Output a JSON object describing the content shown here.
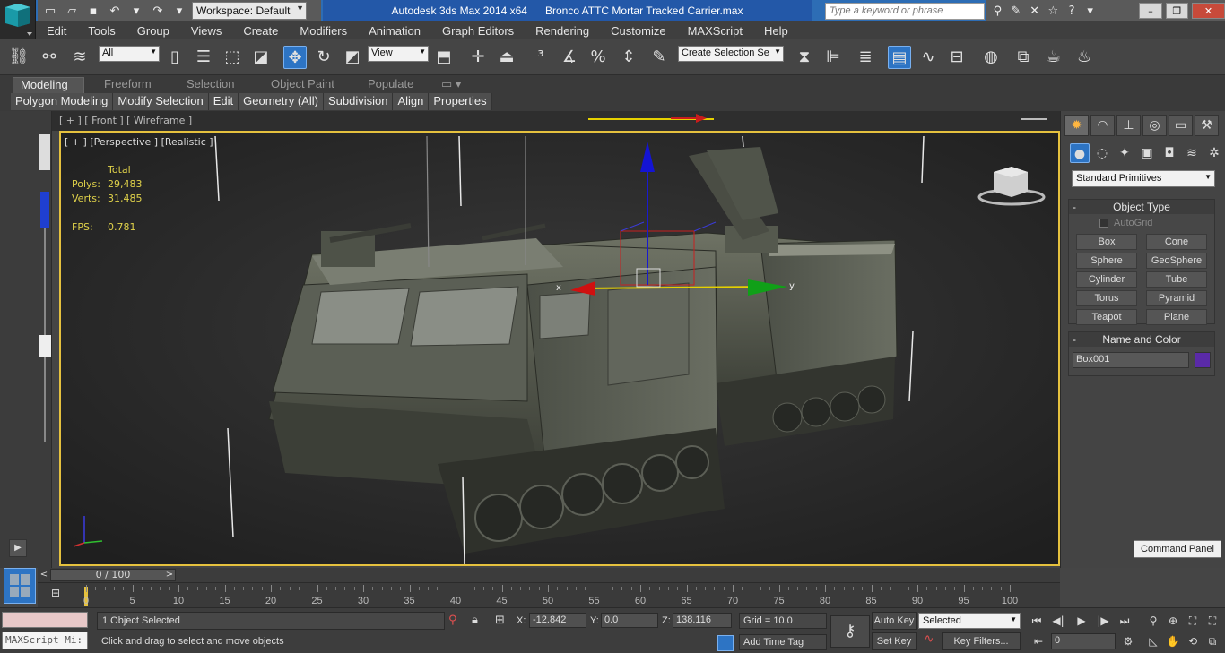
{
  "titlebar": {
    "workspace": "Workspace: Default",
    "app_title": "Autodesk 3ds Max  2014 x64",
    "file_title": "Bronco ATTC Mortar Tracked Carrier.max",
    "search_placeholder": "Type a keyword or phrase"
  },
  "menu": [
    "Edit",
    "Tools",
    "Group",
    "Views",
    "Create",
    "Modifiers",
    "Animation",
    "Graph Editors",
    "Rendering",
    "Customize",
    "MAXScript",
    "Help"
  ],
  "toolbar": {
    "filter": "All",
    "ref_coord": "View",
    "named_selection": "Create Selection Se"
  },
  "ribbon": {
    "tabs": [
      "Modeling",
      "Freeform",
      "Selection",
      "Object Paint",
      "Populate"
    ],
    "panels": [
      "Polygon Modeling",
      "Modify Selection",
      "Edit",
      "Geometry (All)",
      "Subdivision",
      "Align",
      "Properties"
    ]
  },
  "viewport": {
    "top_label": "[ + ] [ Front ] [ Wireframe ]",
    "label": "[ + ] [Perspective ] [Realistic ]",
    "stats_header": "Total",
    "polys_label": "Polys:",
    "polys_value": "29,483",
    "verts_label": "Verts:",
    "verts_value": "31,485",
    "fps_label": "FPS:",
    "fps_value": "0.781",
    "gizmo_x": "x",
    "gizmo_y": "y"
  },
  "command_panel": {
    "category": "Standard Primitives",
    "object_type_title": "Object Type",
    "autogrid": "AutoGrid",
    "buttons": [
      "Box",
      "Cone",
      "Sphere",
      "GeoSphere",
      "Cylinder",
      "Tube",
      "Torus",
      "Pyramid",
      "Teapot",
      "Plane"
    ],
    "name_color_title": "Name and Color",
    "object_name": "Box001",
    "object_color": "#5a2aa8",
    "tooltip": "Command Panel"
  },
  "timeline": {
    "position": "0 / 100",
    "ticks": [
      "0",
      "5",
      "10",
      "15",
      "20",
      "25",
      "30",
      "35",
      "40",
      "45",
      "50",
      "55",
      "60",
      "65",
      "70",
      "75",
      "80",
      "85",
      "90",
      "95",
      "100"
    ]
  },
  "status": {
    "maxscript": "MAXScript Mi:",
    "selection": "1 Object Selected",
    "prompt": "Click and drag to select and move objects",
    "x_label": "X:",
    "x_value": "-12.842",
    "y_label": "Y:",
    "y_value": "0.0",
    "z_label": "Z:",
    "z_value": "138.116",
    "grid": "Grid = 10.0",
    "add_time_tag": "Add Time Tag",
    "auto_key": "Auto Key",
    "set_key": "Set Key",
    "key_mode": "Selected",
    "key_filters": "Key Filters...",
    "current_frame": "0"
  }
}
